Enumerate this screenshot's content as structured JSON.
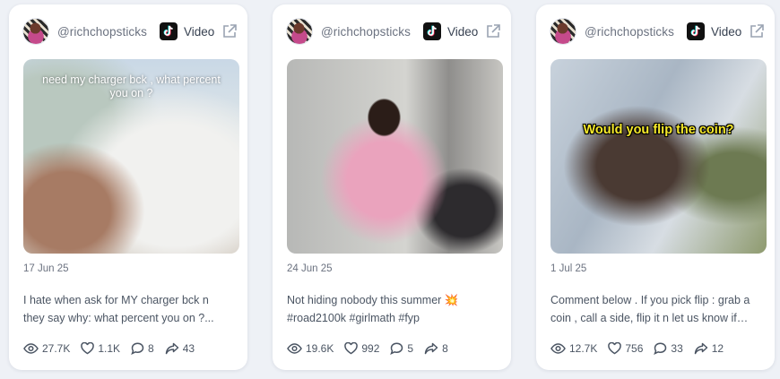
{
  "cards": [
    {
      "handle": "@richchopsticks",
      "platform_label": "Video",
      "overlay_text": "need my charger bck , what percent you on ?",
      "date": "17 Jun 25",
      "description": "I hate when ask for MY charger bck n they say why: what percent you on ?...",
      "stats": {
        "views": "27.7K",
        "likes": "1.1K",
        "comments": "8",
        "shares": "43"
      }
    },
    {
      "handle": "@richchopsticks",
      "platform_label": "Video",
      "date": "24 Jun 25",
      "description": "Not hiding nobody this summer 💥 #road2100k #girlmath #fyp",
      "stats": {
        "views": "19.6K",
        "likes": "992",
        "comments": "5",
        "shares": "8"
      }
    },
    {
      "handle": "@richchopsticks",
      "platform_label": "Video",
      "overlay_text": "Would you flip the coin?",
      "date": "1 Jul 25",
      "description": "Comment below . If you pick flip : grab a coin , call a side, flip it n let us know if yo...",
      "stats": {
        "views": "12.7K",
        "likes": "756",
        "comments": "33",
        "shares": "12"
      }
    }
  ],
  "icons": {
    "platform": "tiktok-icon",
    "external": "external-link-icon",
    "views": "eye-icon",
    "likes": "heart-icon",
    "comments": "comment-icon",
    "shares": "share-icon"
  },
  "colors": {
    "card_bg": "#ffffff",
    "page_bg": "#eef1f6",
    "caption_yellow": "#f7ea2b"
  }
}
